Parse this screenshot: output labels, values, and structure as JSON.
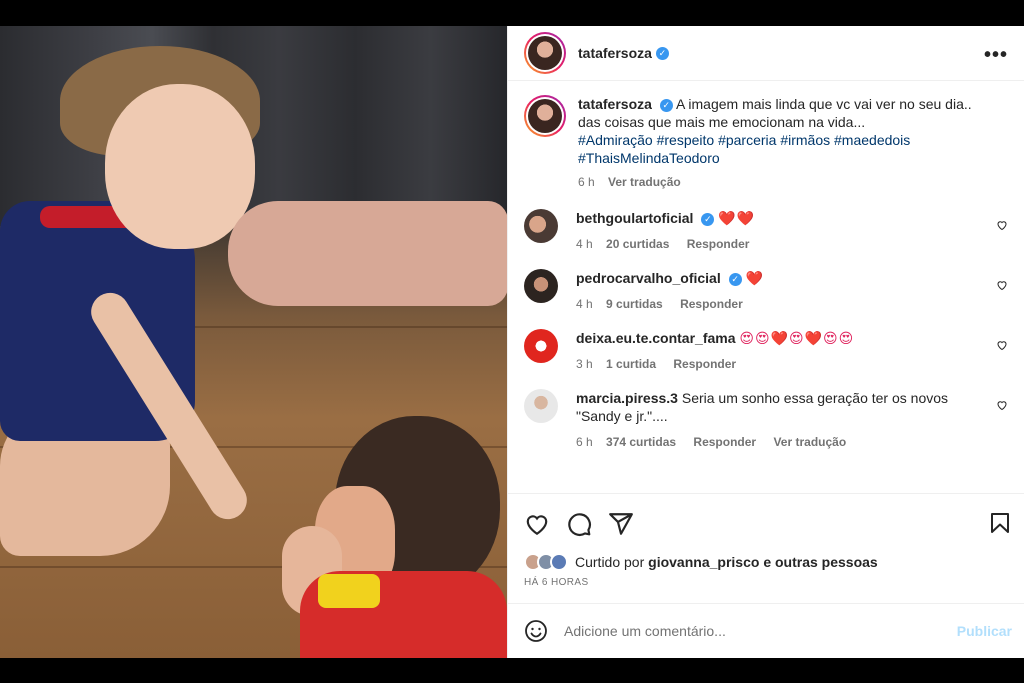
{
  "post": {
    "author": "tatafersoza",
    "more_glyph": "•••",
    "caption_text": "A imagem mais linda que vc vai ver no seu dia.. das coisas que mais me emocionam na vida...",
    "hashtags": "#Admiração #respeito #parceria #irmãos #maededois #ThaisMelindaTeodoro",
    "caption_time": "6 h",
    "translate_label": "Ver tradução"
  },
  "comments": [
    {
      "user": "bethgoulartoficial",
      "verified": true,
      "text": "❤️❤️",
      "time": "4 h",
      "likes": "20 curtidas",
      "reply": "Responder"
    },
    {
      "user": "pedrocarvalho_oficial",
      "verified": true,
      "text": "❤️",
      "time": "4 h",
      "likes": "9 curtidas",
      "reply": "Responder"
    },
    {
      "user": "deixa.eu.te.contar_fama",
      "verified": false,
      "text": "😍😍❤️😍❤️😍😍",
      "time": "3 h",
      "likes": "1 curtida",
      "reply": "Responder"
    },
    {
      "user": "marcia.piress.3",
      "verified": false,
      "text": "Seria um sonho essa geração ter os novos \"Sandy e jr.\"....",
      "time": "6 h",
      "likes": "374 curtidas",
      "reply": "Responder",
      "translate": "Ver tradução"
    }
  ],
  "likes": {
    "prefix": "Curtido por",
    "user": "giovanna_prisco",
    "suffix": "e outras pessoas",
    "posted": "HÁ 6 HORAS"
  },
  "add_comment": {
    "placeholder": "Adicione um comentário...",
    "publish": "Publicar"
  },
  "colors": {
    "verified": "#3897f0",
    "hashtag": "#00376b",
    "heart": "#e0245e",
    "publish_disabled": "#b2dffc"
  },
  "icons": [
    "heart-icon",
    "comment-icon",
    "share-icon",
    "bookmark-icon",
    "emoji-icon",
    "verified-icon",
    "more-icon"
  ]
}
